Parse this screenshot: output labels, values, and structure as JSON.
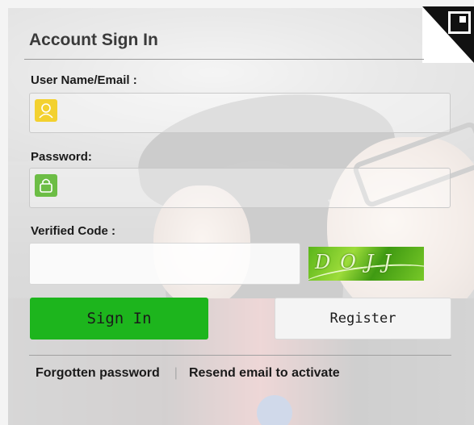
{
  "login": {
    "title": "Account Sign In",
    "username_label": "User Name/Email :",
    "username_value": "",
    "password_label": "Password:",
    "password_value": "",
    "code_label": "Verified Code :",
    "code_value": "",
    "captcha_text": "DOJJ",
    "signin_label": "Sign In",
    "register_label": "Register",
    "forgot_label": "Forgotten password",
    "separator": "|",
    "resend_label": "Resend email to activate"
  },
  "colors": {
    "signin_bg": "#1db51d",
    "user_icon": "#f3d12f",
    "lock_icon": "#6cbd45"
  },
  "icons": {
    "user": "user-icon",
    "lock": "lock-icon",
    "qr": "qr-code-icon"
  }
}
